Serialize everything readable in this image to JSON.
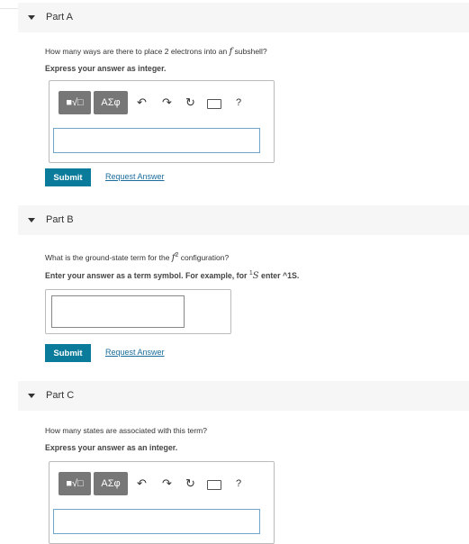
{
  "parts": [
    {
      "title": "Part A",
      "question_pre": "How many ways are there to place 2 electrons into an ",
      "question_var": "f",
      "question_post": " subshell?",
      "instruction": "Express your answer as integer.",
      "submit_label": "Submit",
      "request_label": "Request Answer"
    },
    {
      "title": "Part B",
      "question_pre": "What is the ground-state term for the ",
      "question_var": "f",
      "question_sup": "2",
      "question_post": " configuration?",
      "instruction_pre": "Enter your answer as a term symbol. For example, for ",
      "instruction_sup": "1",
      "instruction_var": "S",
      "instruction_post": " enter ^1S.",
      "submit_label": "Submit",
      "request_label": "Request Answer"
    },
    {
      "title": "Part C",
      "question": "How many states are associated with this term?",
      "instruction": "Express your answer as an integer."
    }
  ],
  "toolbar": {
    "templates_label": "■√□",
    "symbols_label": "ΑΣφ",
    "undo_glyph": "↶",
    "redo_glyph": "↷",
    "reset_glyph": "↻",
    "help_glyph": "?"
  },
  "colors": {
    "submit_bg": "#0b7b9b",
    "link": "#1a6c9c",
    "header_bg": "#f6f6f6"
  }
}
